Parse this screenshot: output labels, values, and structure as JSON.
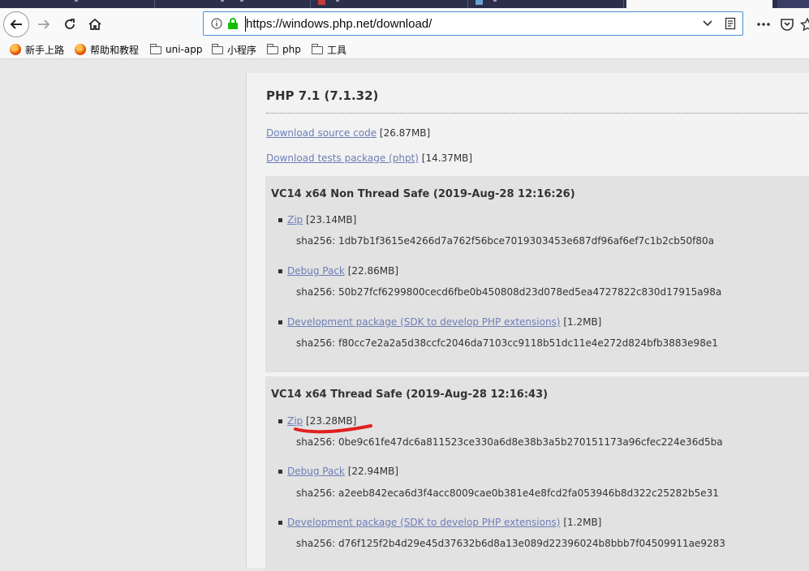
{
  "browser": {
    "url": "https://windows.php.net/download/",
    "bookmarks": [
      {
        "label": "新手上路",
        "icon": "firefox-icon"
      },
      {
        "label": "帮助和教程",
        "icon": "firefox-icon"
      },
      {
        "label": "uni-app",
        "icon": "folder-icon"
      },
      {
        "label": "小程序",
        "icon": "folder-icon"
      },
      {
        "label": "php",
        "icon": "folder-icon"
      },
      {
        "label": "工具",
        "icon": "folder-icon"
      }
    ],
    "colors": {
      "url_border": "#4a90d9",
      "lock": "#12bc00",
      "link": "#6c7eb7",
      "annotation": "#e02020"
    }
  },
  "page": {
    "section_title": "PHP 7.1 (7.1.32)",
    "source": {
      "link": "Download source code",
      "size": "[26.87MB]"
    },
    "tests": {
      "link": "Download tests package (phpt)",
      "size": "[14.37MB]"
    },
    "builds": [
      {
        "title": "VC14 x64 Non Thread Safe (2019-Aug-28 12:16:26)",
        "items": [
          {
            "link": "Zip",
            "size": "[23.14MB]",
            "sha": "sha256: 1db7b1f3615e4266d7a762f56bce7019303453e687df96af6ef7c1b2cb50f80a"
          },
          {
            "link": "Debug Pack",
            "size": "[22.86MB]",
            "sha": "sha256: 50b27fcf6299800cecd6fbe0b450808d23d078ed5ea4727822c830d17915a98a"
          },
          {
            "link": "Development package (SDK to develop PHP extensions)",
            "size": "[1.2MB]",
            "sha": "sha256: f80cc7e2a2a5d38ccfc2046da7103cc9118b51dc11e4e272d824bfb3883e98e1"
          }
        ]
      },
      {
        "title": "VC14 x64 Thread Safe (2019-Aug-28 12:16:43)",
        "items": [
          {
            "link": "Zip",
            "size": "[23.28MB]",
            "sha": "sha256: 0be9c61fe47dc6a811523ce330a6d8e38b3a5b270151173a96cfec224e36d5ba"
          },
          {
            "link": "Debug Pack",
            "size": "[22.94MB]",
            "sha": "sha256: a2eeb842eca6d3f4acc8009cae0b381e4e8fcd2fa053946b8d322c25282b5e31"
          },
          {
            "link": "Development package (SDK to develop PHP extensions)",
            "size": "[1.2MB]",
            "sha": "sha256: d76f125f2b4d29e45d37632b6d8a13e089d22396024b8bbb7f04509911ae9283"
          }
        ]
      }
    ]
  }
}
